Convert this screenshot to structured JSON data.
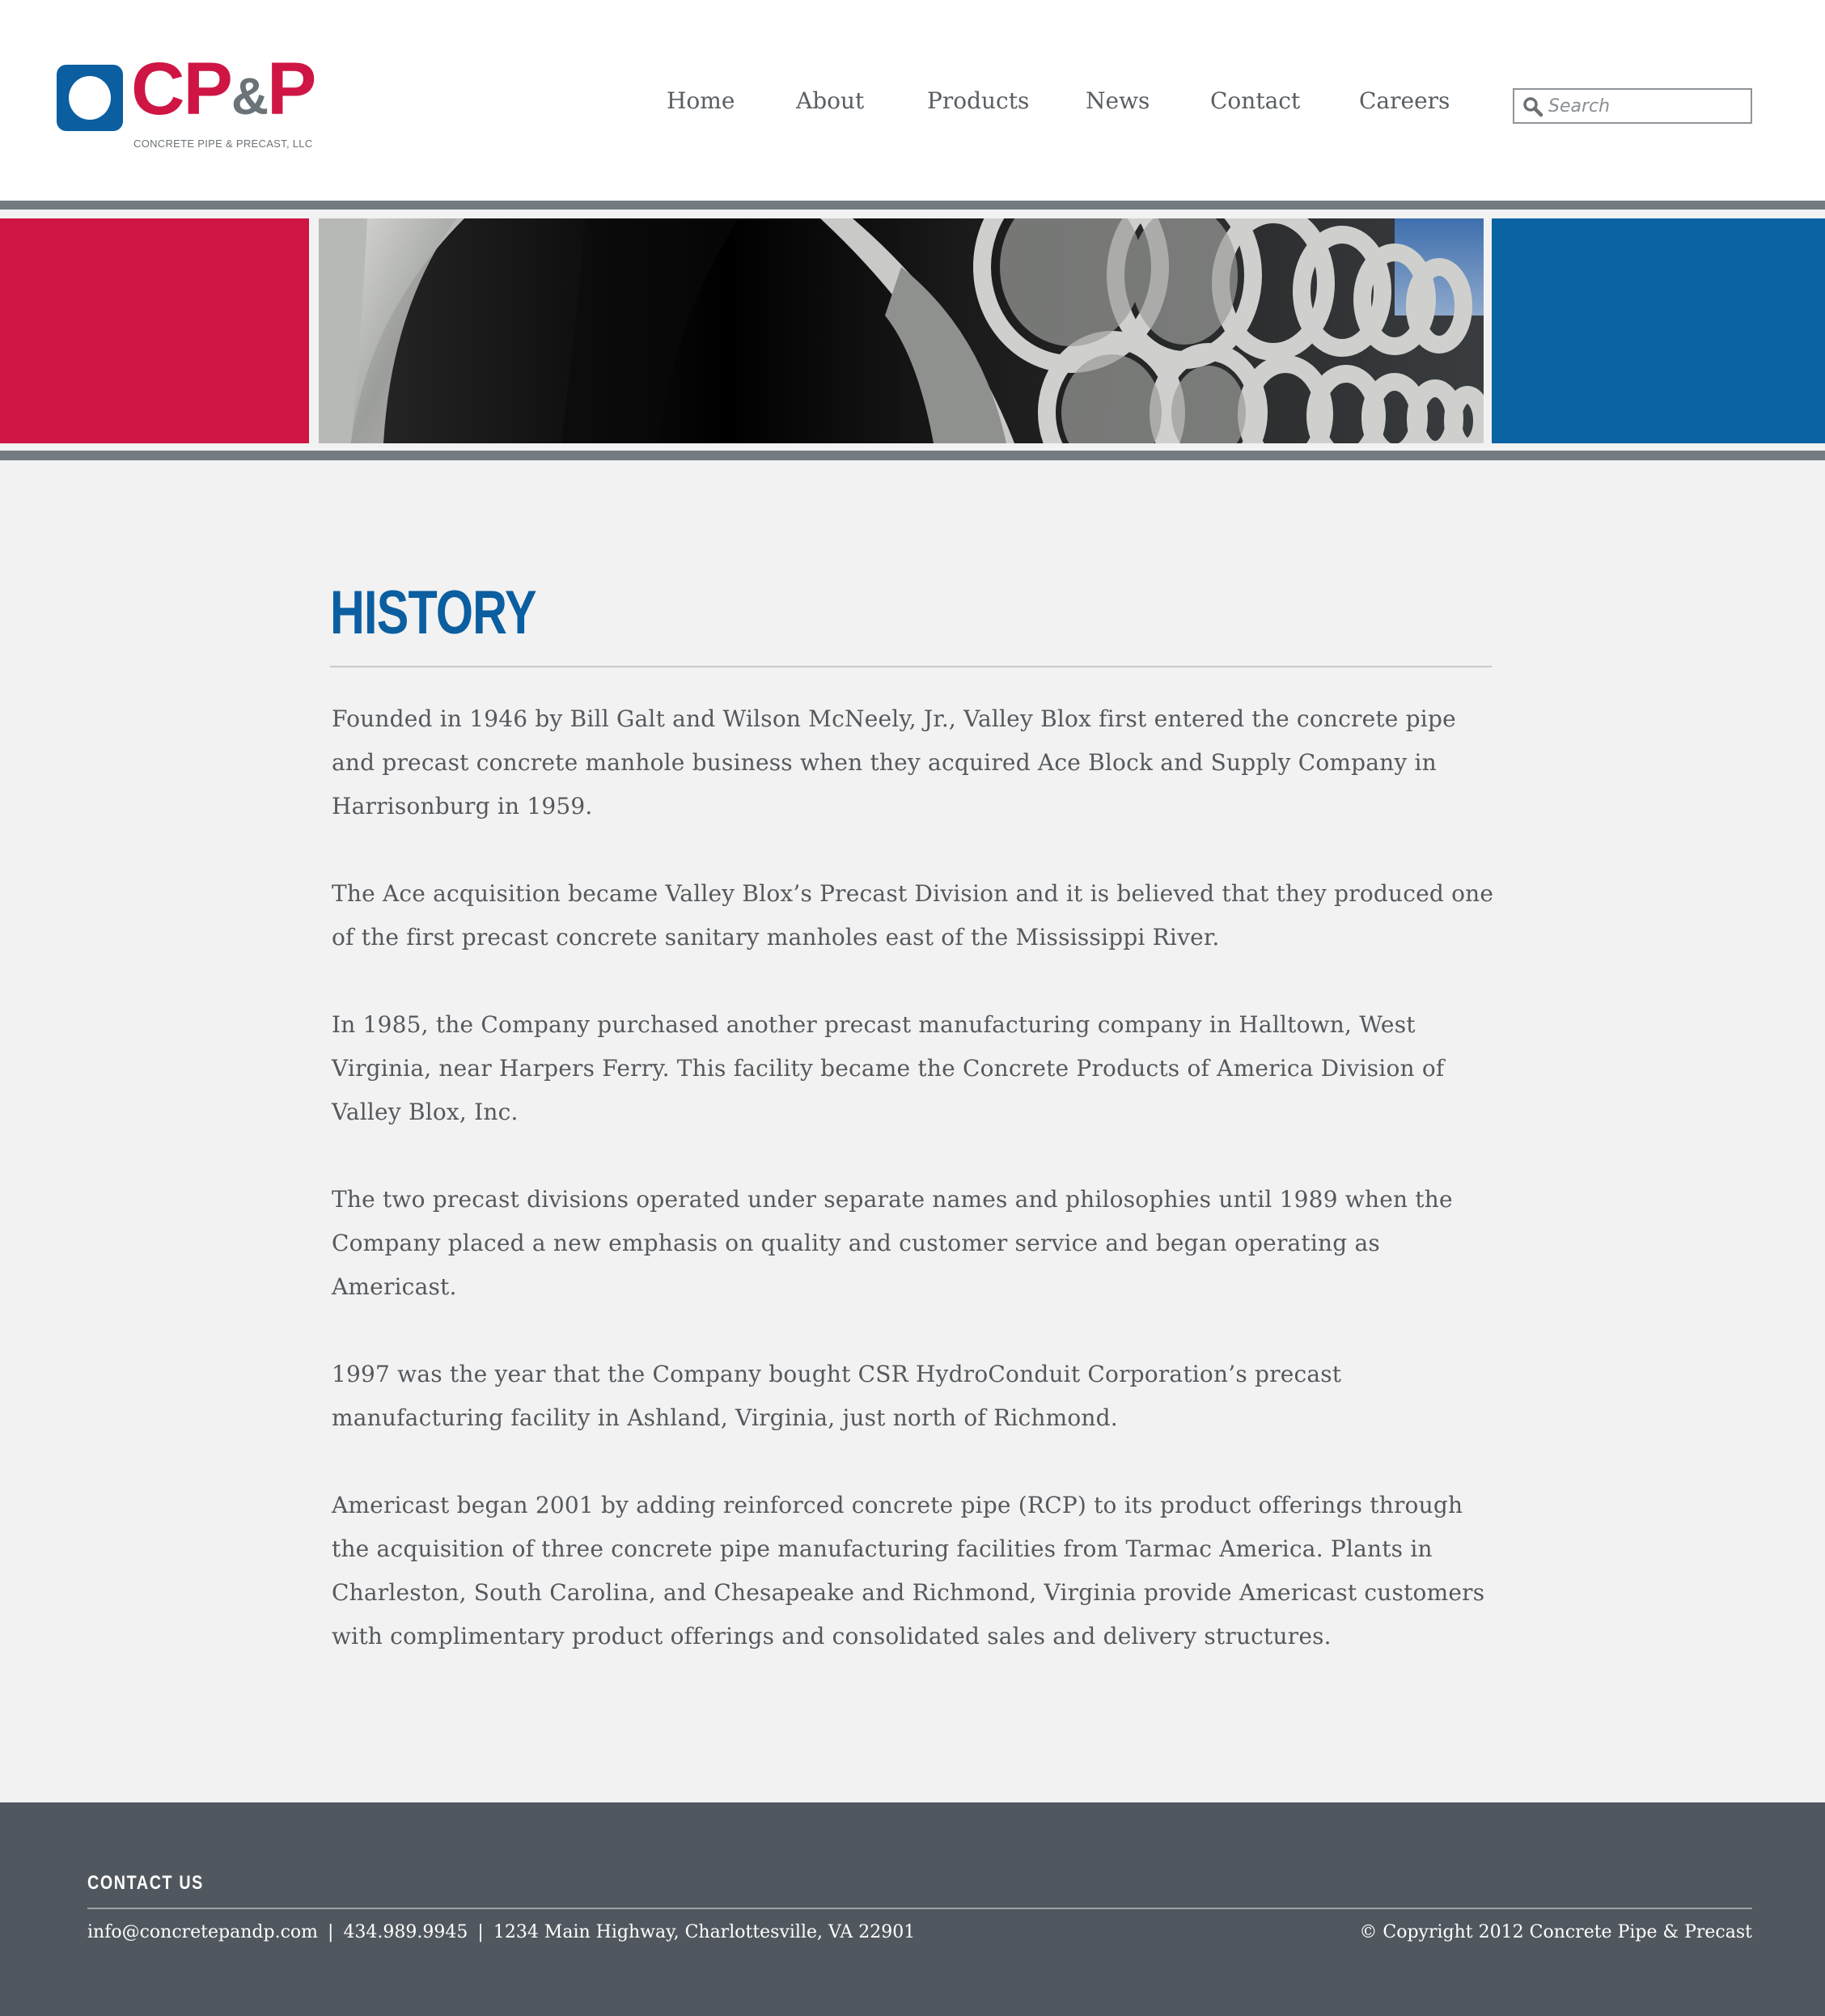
{
  "brand": {
    "logo_text_cp": "CP",
    "logo_text_amp": "&",
    "logo_text_p": "P",
    "logo_subtitle": "CONCRETE PIPE & PRECAST, LLC",
    "colors": {
      "red": "#cf1544",
      "blue": "#0b5ea0",
      "gray": "#6b7378"
    }
  },
  "nav": {
    "items": [
      "Home",
      "About",
      "Products",
      "News",
      "Contact",
      "Careers"
    ]
  },
  "search": {
    "placeholder": "Search",
    "value": ""
  },
  "banner": {
    "photo_icon": "concrete-pipes-photo"
  },
  "main": {
    "title": "HISTORY",
    "paragraphs": [
      "Founded in 1946 by Bill Galt and Wilson McNeely, Jr., Valley Blox first entered the concrete pipe and precast concrete manhole business when they acquired Ace Block and Supply Company in Harrisonburg in 1959.",
      "The Ace acquisition became Valley Blox’s Precast Division and it is believed that they produced one of the first precast concrete sanitary manholes east of the Mississippi River.",
      "In 1985, the Company purchased another precast manufacturing company in Halltown, West Virginia, near Harpers Ferry. This facility became the Concrete Products of America Division of Valley Blox, Inc.",
      "The two precast divisions operated under separate names and philosophies until 1989 when the Company placed a new emphasis on quality and customer service and began operating as Americast.",
      "1997 was the year that the Company bought CSR HydroConduit Corporation’s precast manufacturing facility in Ashland, Virginia, just north of Richmond.",
      "Americast began 2001 by adding reinforced concrete pipe (RCP) to its product offerings through the acquisition of three concrete pipe manufacturing facilities from Tarmac America. Plants in Charleston, South Carolina, and Chesapeake and Richmond, Virginia provide Americast customers with complimentary product offerings and consolidated sales and delivery structures."
    ]
  },
  "footer": {
    "heading": "CONTACT US",
    "email": "info@concretepandp.com",
    "separator": "|",
    "phone": "434.989.9945",
    "address": "1234 Main Highway, Charlottesville, VA 22901",
    "copyright": "© Copyright 2012 Concrete Pipe & Precast"
  }
}
